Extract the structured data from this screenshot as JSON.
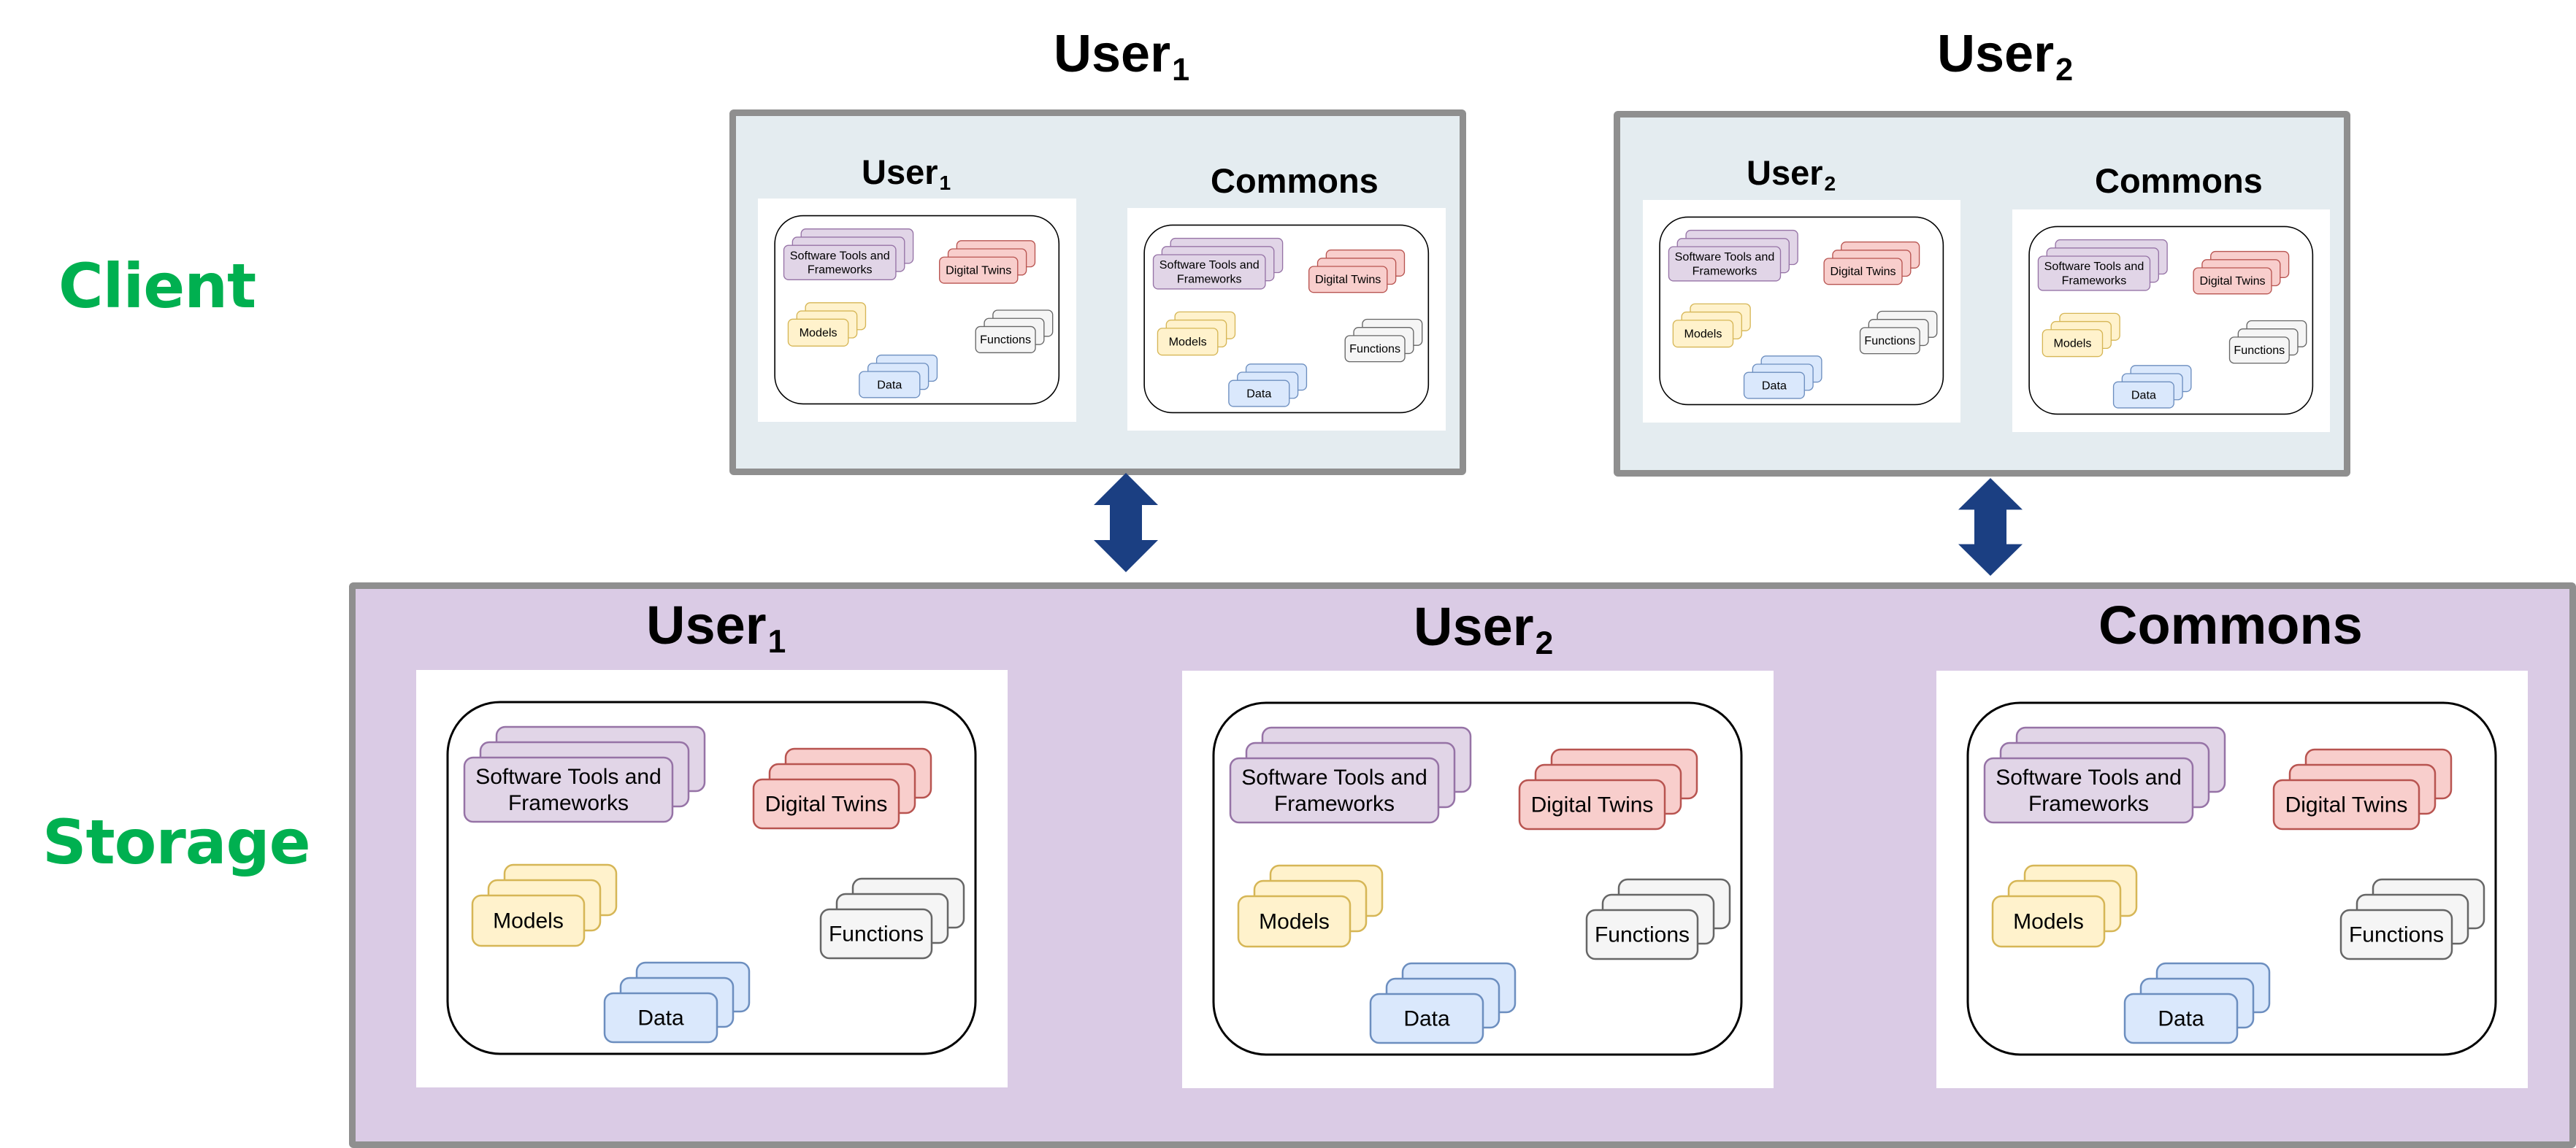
{
  "row_labels": {
    "client": "Client",
    "storage": "Storage",
    "color": "#00B050"
  },
  "colors": {
    "client_fill": "#E4ECF0",
    "storage_fill": "#DACBE5",
    "box_border": "#8F8F8F",
    "arrow": "#1B3F82"
  },
  "client": {
    "boxes": [
      {
        "title": "User",
        "title_sub": "1",
        "panels": [
          {
            "title": "User",
            "title_sub": "1"
          },
          {
            "title": "Commons",
            "title_sub": ""
          }
        ]
      },
      {
        "title": "User",
        "title_sub": "2",
        "panels": [
          {
            "title": "User",
            "title_sub": "2"
          },
          {
            "title": "Commons",
            "title_sub": ""
          }
        ]
      }
    ]
  },
  "storage": {
    "panels": [
      {
        "title": "User",
        "title_sub": "1"
      },
      {
        "title": "User",
        "title_sub": "2"
      },
      {
        "title": "Commons",
        "title_sub": ""
      }
    ]
  },
  "connectors": [
    {
      "from": "client.User1",
      "to": "storage",
      "direction": "bidirectional"
    },
    {
      "from": "client.User2",
      "to": "storage",
      "direction": "bidirectional"
    }
  ],
  "resource_cards": [
    {
      "id": "software",
      "lines": [
        "Software Tools and",
        "Frameworks"
      ],
      "fill": "#E1D5E7",
      "stroke": "#9673A6"
    },
    {
      "id": "digital-twins",
      "lines": [
        "Digital Twins"
      ],
      "fill": "#F8CECC",
      "stroke": "#B85450"
    },
    {
      "id": "models",
      "lines": [
        "Models"
      ],
      "fill": "#FFF2CC",
      "stroke": "#D6B656"
    },
    {
      "id": "functions",
      "lines": [
        "Functions"
      ],
      "fill": "#F5F5F5",
      "stroke": "#666666"
    },
    {
      "id": "data",
      "lines": [
        "Data"
      ],
      "fill": "#DAE8FC",
      "stroke": "#6C8EBF"
    }
  ]
}
